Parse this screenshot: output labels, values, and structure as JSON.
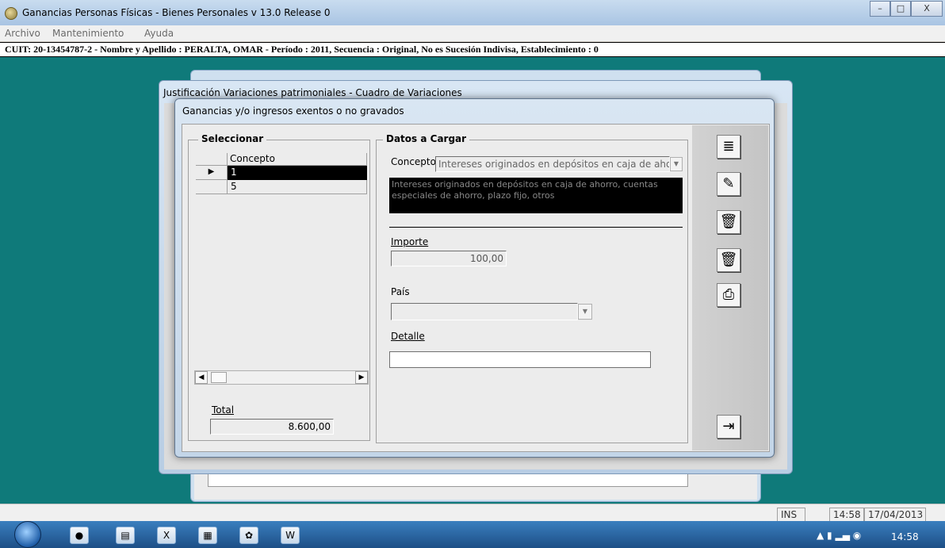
{
  "window": {
    "title": "Ganancias Personas Físicas - Bienes Personales v 13.0 Release 0",
    "minimize": "–",
    "maximize": "□",
    "close": "X"
  },
  "menubar": [
    "Archivo",
    "Mantenimiento",
    "Ayuda"
  ],
  "infobar": "CUIT: 20-13454787-2 - Nombre y Apellido : PERALTA, OMAR - Período : 2011, Secuencia : Original, No es Sucesión Indivisa, Establecimiento : 0",
  "background_windows": {
    "behind_title": "Justificación Variaciones patrimoniales - Cuadro de Variaciones"
  },
  "dialog": {
    "title": "Ganancias y/o ingresos exentos o no gravados",
    "seleccionar": {
      "label": "Seleccionar",
      "column": "Concepto",
      "rows": [
        "1",
        "5"
      ]
    },
    "total": {
      "label": "Total",
      "value": "8.600,00"
    },
    "datos": {
      "label": "Datos a Cargar",
      "concepto_label": "Concepto",
      "concepto_value": "Intereses originados en depósitos en caja de ahorrc",
      "description": "Intereses originados en depósitos en caja de ahorro, cuentas especiales de ahorro, plazo fijo, otros",
      "importe_label": "Importe",
      "importe_value": "100,00",
      "pais_label": "País",
      "pais_value": "",
      "detalle_label": "Detalle",
      "detalle_value": ""
    },
    "toolbar": [
      "list-icon",
      "edit-icon",
      "delete-icon",
      "trash-icon",
      "print-icon",
      "exit-icon"
    ]
  },
  "statusbar": {
    "ins": "INS",
    "time": "14:58",
    "date": "17/04/2013"
  },
  "taskbar": {
    "clock": "14:58",
    "items": [
      "chrome-icon",
      "folder-icon",
      "excel-icon",
      "afip-icon",
      "app-icon",
      "word-icon"
    ]
  },
  "colors": {
    "workspace": "#0f7a7a",
    "selected_row": "#000000",
    "taskbar": "#1d4f86"
  }
}
